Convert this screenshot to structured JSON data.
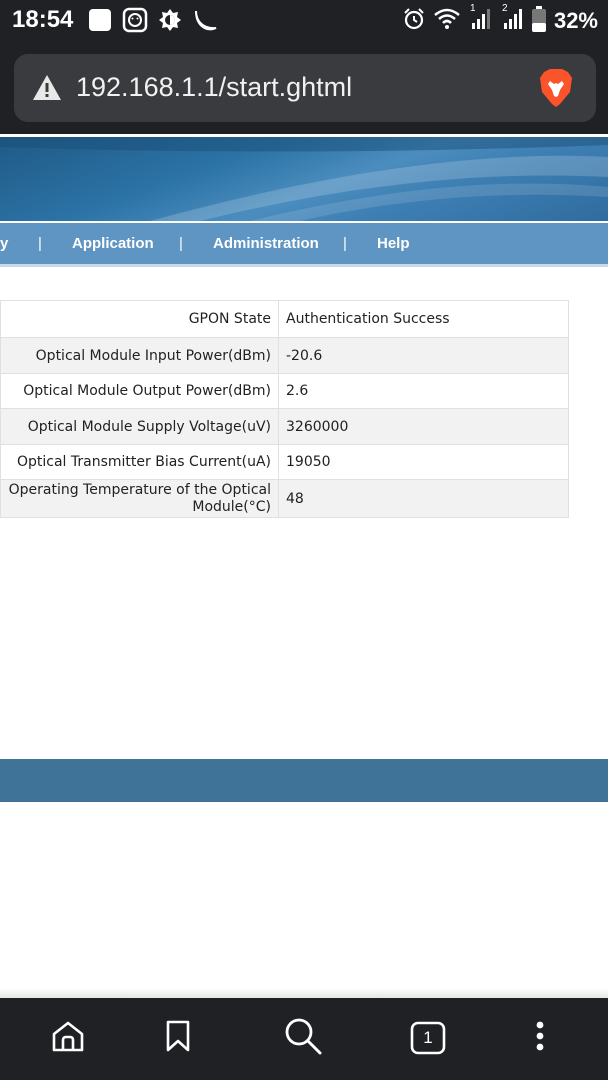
{
  "status_bar": {
    "time": "18:54",
    "battery_percent": "32%",
    "sim1_label": "1",
    "sim2_label": "2",
    "icons_left": [
      "notification-square-icon",
      "app-face-icon",
      "brightness-icon",
      "moon-icon"
    ],
    "icons_right": [
      "alarm-icon",
      "wifi-icon",
      "signal-sim1-icon",
      "signal-sim2-icon",
      "battery-icon"
    ]
  },
  "browser": {
    "url": "192.168.1.1/start.ghtml",
    "security_icon": "warning-triangle-icon",
    "browser_icon": "brave-lion-icon"
  },
  "nav": {
    "items": [
      {
        "label": "y"
      },
      {
        "label": "Application"
      },
      {
        "label": "Administration"
      },
      {
        "label": "Help"
      }
    ],
    "separator": "|"
  },
  "gpon_info": {
    "rows": [
      {
        "label": "GPON State",
        "value": "Authentication Success"
      },
      {
        "label": "Optical Module Input Power(dBm)",
        "value": "-20.6"
      },
      {
        "label": "Optical Module Output Power(dBm)",
        "value": "2.6"
      },
      {
        "label": "Optical Module Supply Voltage(uV)",
        "value": "3260000"
      },
      {
        "label": "Optical Transmitter Bias Current(uA)",
        "value": "19050"
      },
      {
        "label": "Operating Temperature of the Optical Module(°C)",
        "value": "48"
      }
    ]
  },
  "bottom_nav": {
    "tab_count": "1",
    "buttons": [
      "home-icon",
      "bookmark-icon",
      "search-icon",
      "tabs-icon",
      "more-menu-icon"
    ]
  },
  "colors": {
    "system_bar": "#202124",
    "url_box": "#3a3b3e",
    "nav_bar": "#5e95c3",
    "footer_band": "#3f7397",
    "brave_orange": "#fb542b"
  }
}
